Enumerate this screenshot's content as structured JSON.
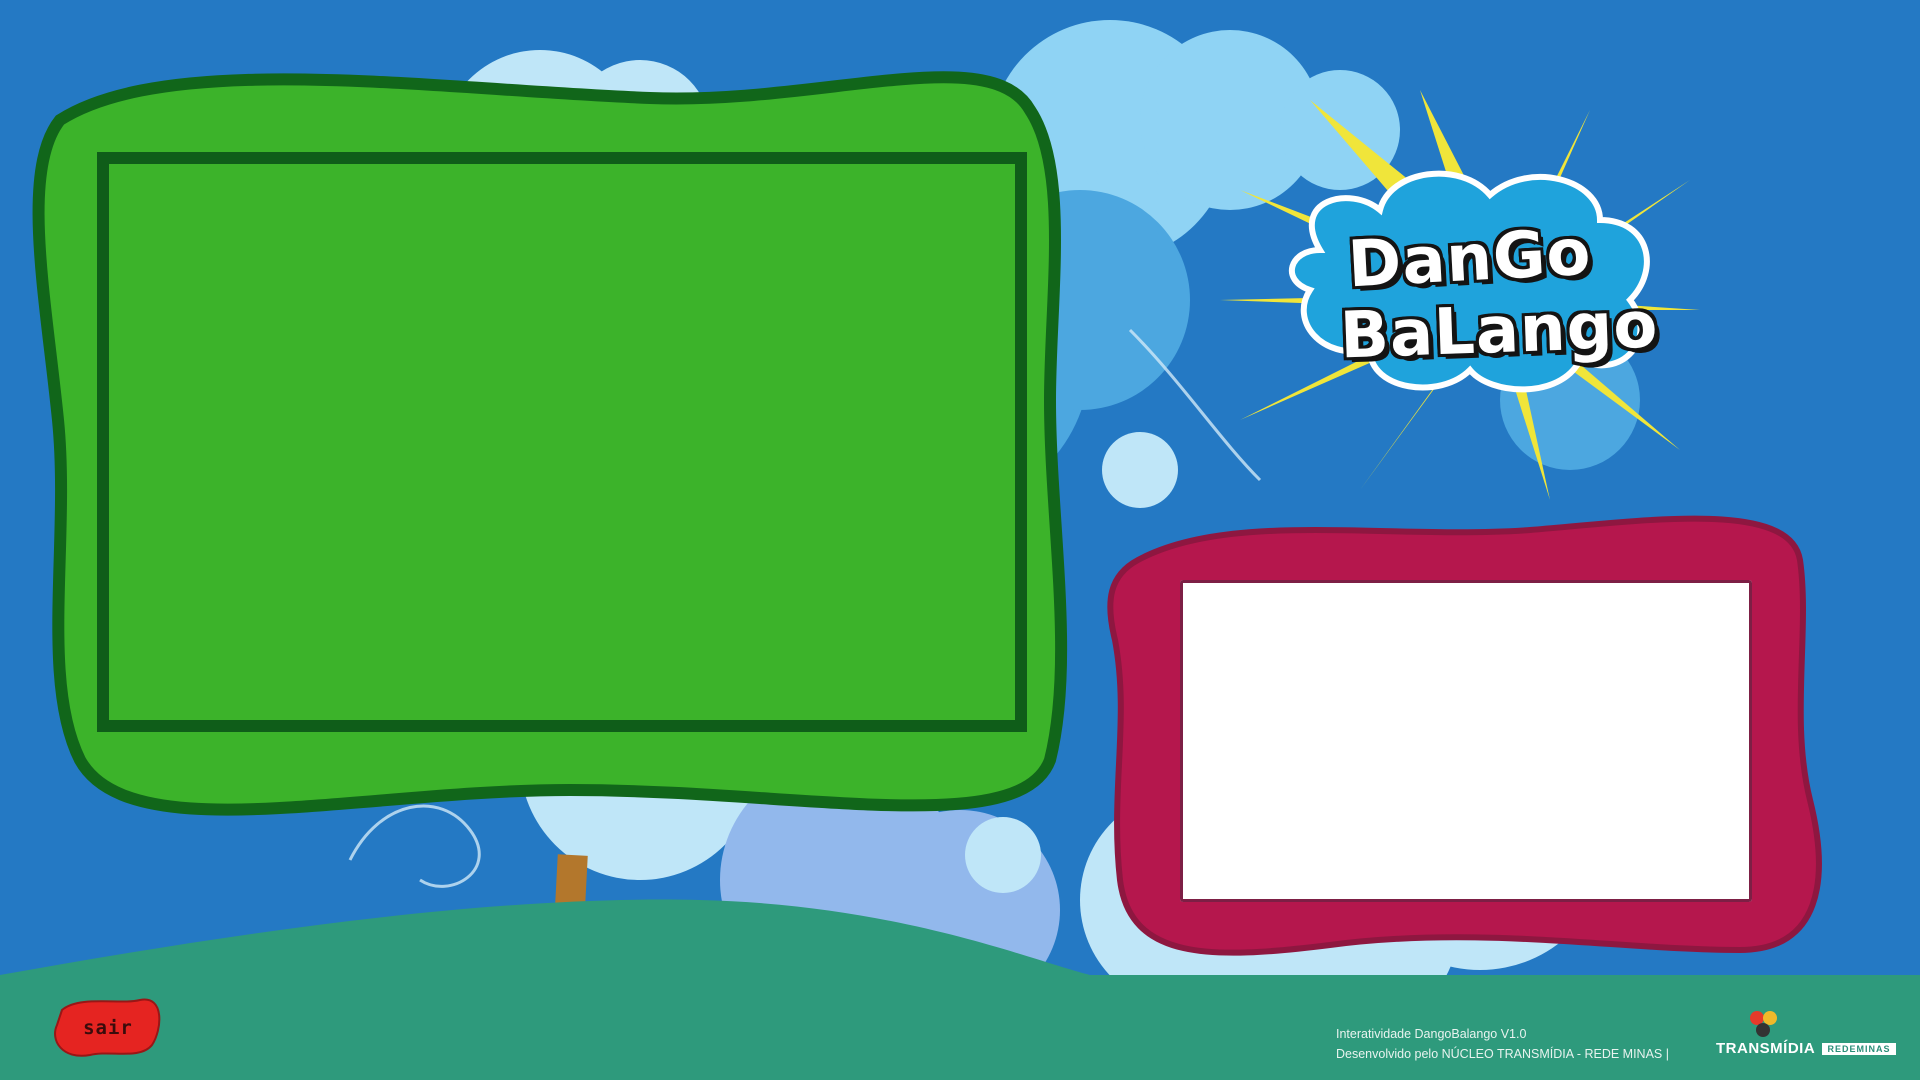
{
  "app": {
    "logo_line1": "DanGo",
    "logo_line2": "BaLango"
  },
  "controls": {
    "exit_label": "sair"
  },
  "footer": {
    "credit_line1": "Interatividade DangoBalango V1.0",
    "credit_line2": "Desenvolvido pelo NÚCLEO TRANSMÍDIA -  REDE MINAS  |",
    "brand_transmidia": "TRANSMÍDIA",
    "brand_redeminas": "REDEMINAS"
  },
  "colors": {
    "background": "#2479c4",
    "grass": "#2e9a7c",
    "green_frame": "#3cb32a",
    "red_frame": "#b5174d",
    "exit_button": "#e52421",
    "sun": "#f0e53a",
    "cloud_logo": "#1fa3dc"
  },
  "icons": {
    "exit": "blob-button-icon",
    "brand": "transmidia-logo-icon"
  }
}
